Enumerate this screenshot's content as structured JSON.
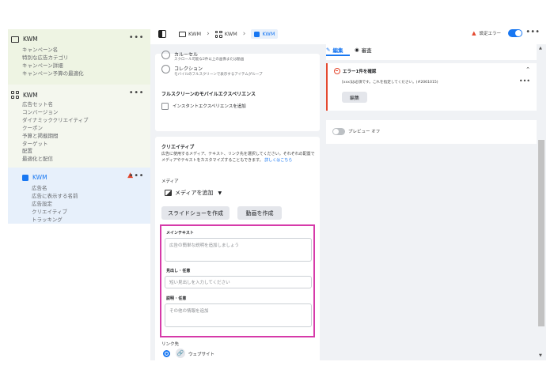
{
  "sidebar": {
    "campaign": {
      "title": "KWM",
      "items": [
        "キャンペーン名",
        "特別な広告カテゴリ",
        "キャンペーン詳細",
        "キャンペーン予算の最適化"
      ]
    },
    "adset": {
      "title": "KWM",
      "items": [
        "広告セット名",
        "コンバージョン",
        "ダイナミッククリエイティブ",
        "クーポン",
        "予算と掲載期間",
        "ターゲット",
        "配置",
        "最適化と配信"
      ]
    },
    "ad": {
      "title": "KWM",
      "items": [
        "広告名",
        "広告に表示する名前",
        "広告設定",
        "クリエイティブ",
        "トラッキング"
      ]
    },
    "more": "•••"
  },
  "topbar": {
    "crumbs": [
      "KWM",
      "KWM",
      "KWM"
    ],
    "status_text": "設定エラー",
    "more": "•••"
  },
  "middle": {
    "option1": {
      "title": "カルーセル",
      "desc": "スクロール可能な2件以上の画像または動画"
    },
    "option2": {
      "title": "コレクション",
      "desc": "モバイルのフルスクリーンで表示するアイテムグループ"
    },
    "fullscreen_title": "フルスクリーンのモバイルエクスペリエンス",
    "instant_exp": "インスタントエクスペリエンスを追加",
    "creative": {
      "title": "クリエイティブ",
      "desc": "広告に使用するメディア、テキスト、リンク先を選択してください。それぞれの配置でメディアやテキストをカスタマイズすることもできます。",
      "desc_link": "詳しくはこちら",
      "media_label": "メディア",
      "add_media": "メディアを追加",
      "slideshow_btn": "スライドショーを作成",
      "video_btn": "動画を作成",
      "main_text_label": "メインテキスト",
      "main_text_placeholder": "広告の簡単な説明を追加しましょう",
      "headline_label": "見出し · 任意",
      "headline_placeholder": "短い見出しを入力してください",
      "description_label": "説明 · 任意",
      "description_placeholder": "その他の情報を追加",
      "link_label": "リンク先",
      "website_label": "ウェブサイト"
    }
  },
  "right": {
    "tab_edit": "編集",
    "tab_review": "審査",
    "error": {
      "title": "エラー1件を確認",
      "message": "[xxx]は必須です。これを指定してください。(#2061015)",
      "fix_btn": "編集"
    },
    "preview_label": "プレビュー オフ"
  },
  "colors": {
    "accent": "#1877f2",
    "error": "#e4492f",
    "highlight": "#d63aa9"
  }
}
